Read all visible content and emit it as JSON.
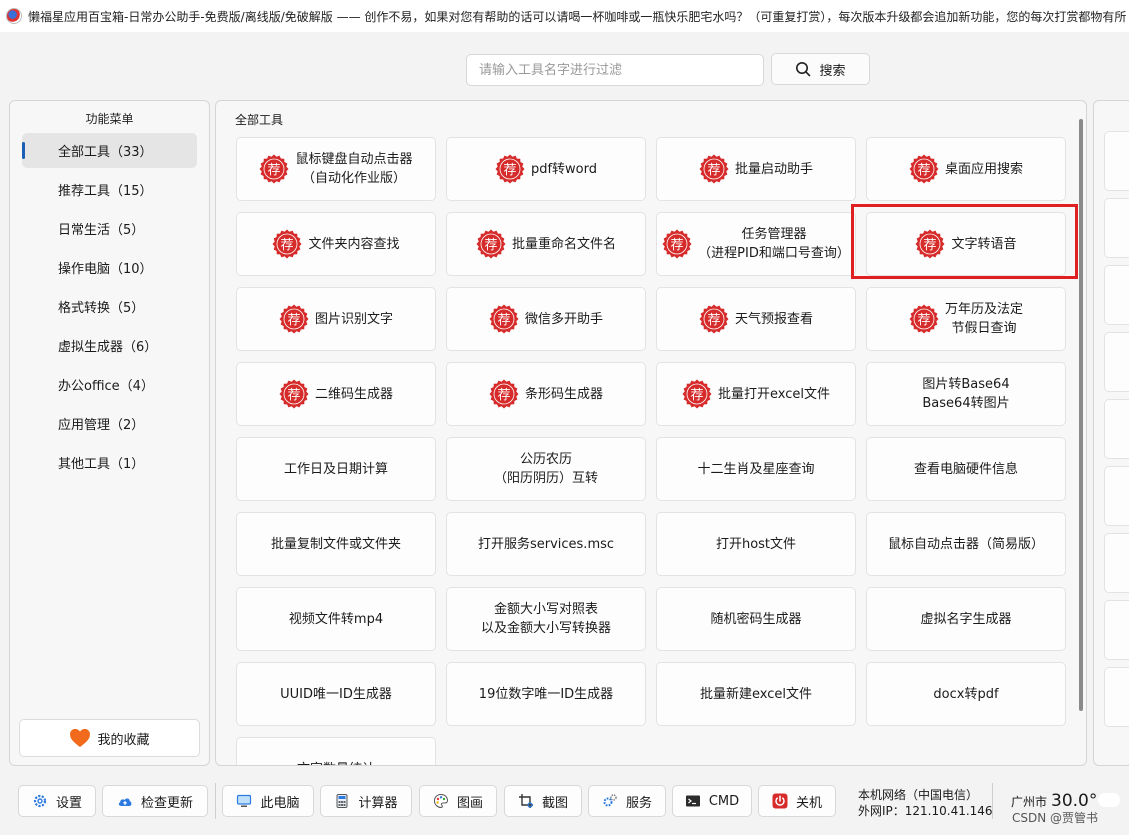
{
  "window": {
    "title": "懒福星应用百宝箱-日常办公助手-免费版/离线版/免破解版 —— 创作不易，如果对您有帮助的话可以请喝一杯咖啡或一瓶快乐肥宅水吗？（可重复打赏），每次版本升级都会追加新功能，您的每次打赏都物有所"
  },
  "search": {
    "placeholder": "请输入工具名字进行过滤",
    "value": "",
    "button_label": "搜索",
    "icon": "search-icon"
  },
  "sidebar": {
    "title": "功能菜单",
    "items": [
      {
        "label": "全部工具（33）",
        "active": true
      },
      {
        "label": "推荐工具（15）"
      },
      {
        "label": "日常生活（5）"
      },
      {
        "label": "操作电脑（10）"
      },
      {
        "label": "格式转换（5）"
      },
      {
        "label": "虚拟生成器（6）"
      },
      {
        "label": "办公office（4）"
      },
      {
        "label": "应用管理（2）"
      },
      {
        "label": "其他工具（1）"
      }
    ],
    "favorites_label": "我的收藏",
    "favorites_icon": "heart-icon"
  },
  "main": {
    "title": "全部工具",
    "stamp_char": "荐",
    "stamp_color": "#d62b2b",
    "highlight_color": "#e02020",
    "tools": [
      {
        "label": "鼠标键盘自动点击器\n（自动化作业版）",
        "recommended": true
      },
      {
        "label": "pdf转word",
        "recommended": true
      },
      {
        "label": "批量启动助手",
        "recommended": true
      },
      {
        "label": "桌面应用搜索",
        "recommended": true
      },
      {
        "label": "文件夹内容查找",
        "recommended": true
      },
      {
        "label": "批量重命名文件名",
        "recommended": true
      },
      {
        "label": "任务管理器\n（进程PID和端口号查询）",
        "recommended": true
      },
      {
        "label": "文字转语音",
        "recommended": true,
        "highlighted": true
      },
      {
        "label": "图片识别文字",
        "recommended": true
      },
      {
        "label": "微信多开助手",
        "recommended": true
      },
      {
        "label": "天气预报查看",
        "recommended": true
      },
      {
        "label": "万年历及法定\n节假日查询",
        "recommended": true
      },
      {
        "label": "二维码生成器",
        "recommended": true
      },
      {
        "label": "条形码生成器",
        "recommended": true
      },
      {
        "label": "批量打开excel文件",
        "recommended": true
      },
      {
        "label": "图片转Base64\nBase64转图片"
      },
      {
        "label": "工作日及日期计算"
      },
      {
        "label": "公历农历\n（阳历阴历）互转"
      },
      {
        "label": "十二生肖及星座查询"
      },
      {
        "label": "查看电脑硬件信息"
      },
      {
        "label": "批量复制文件或文件夹"
      },
      {
        "label": "打开服务services.msc"
      },
      {
        "label": "打开host文件"
      },
      {
        "label": "鼠标自动点击器（简易版）"
      },
      {
        "label": "视频文件转mp4"
      },
      {
        "label": "金额大小写对照表\n以及金额大小写转换器"
      },
      {
        "label": "随机密码生成器"
      },
      {
        "label": "虚拟名字生成器"
      },
      {
        "label": "UUID唯一ID生成器"
      },
      {
        "label": "19位数字唯一ID生成器"
      },
      {
        "label": "批量新建excel文件"
      },
      {
        "label": "docx转pdf"
      },
      {
        "label": "文字数量统计"
      }
    ]
  },
  "bottombar": {
    "buttons": [
      {
        "label": "设置",
        "icon": "gear-icon"
      },
      {
        "label": "检查更新",
        "icon": "cloud-upload-icon"
      },
      {
        "label": "此电脑",
        "icon": "monitor-icon"
      },
      {
        "label": "计算器",
        "icon": "calculator-icon"
      },
      {
        "label": "图画",
        "icon": "palette-icon"
      },
      {
        "label": "截图",
        "icon": "screenshot-icon"
      },
      {
        "label": "服务",
        "icon": "services-icon"
      },
      {
        "label": "CMD",
        "icon": "terminal-icon"
      },
      {
        "label": "关机",
        "icon": "power-icon"
      }
    ],
    "network_line": "本机网络（中国电信）",
    "ip_line": "外网IP：121.10.41.146",
    "city": "广州市",
    "temperature": "30.0°"
  },
  "watermark": "CSDN @贾管书"
}
